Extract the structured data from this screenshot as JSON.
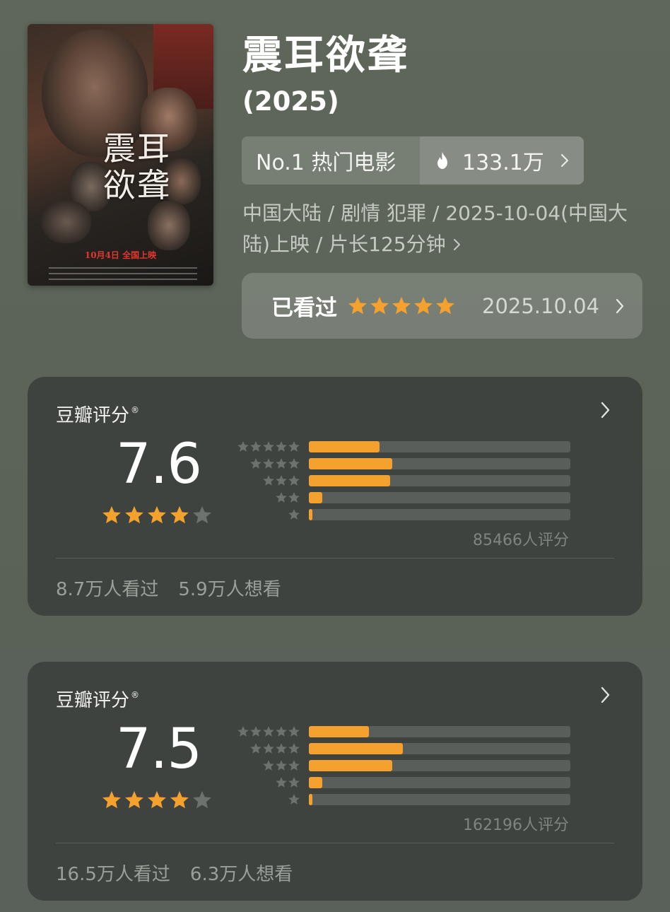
{
  "movie": {
    "poster_title": "震耳欲聋",
    "poster_release": "10月4日 全国上映",
    "title": "震耳欲聋",
    "year": "(2025)",
    "rank_label": "No.1 热门电影",
    "heat": "133.1万",
    "meta": "中国大陆 / 剧情 犯罪 / 2025-10-04(中国大陆)上映 / 片长125分钟",
    "watched": {
      "label": "已看过",
      "stars": 5,
      "date": "2025.10.04"
    }
  },
  "ratings": [
    {
      "title": "豆瓣评分",
      "mark": "®",
      "score": "7.6",
      "stars": 4,
      "distribution": [
        0.27,
        0.32,
        0.31,
        0.05,
        0.01
      ],
      "count": "85466人评分",
      "seen": "8.7万人看过",
      "want": "5.9万人想看"
    },
    {
      "title": "豆瓣评分",
      "mark": "®",
      "score": "7.5",
      "stars": 4,
      "distribution": [
        0.23,
        0.36,
        0.32,
        0.05,
        0.01
      ],
      "count": "162196人评分",
      "seen": "16.5万人看过",
      "want": "6.3万人想看"
    }
  ],
  "colors": {
    "star_active": "#f4a22d",
    "star_inactive": "#6e726d",
    "bar_fill": "#f4a22d"
  },
  "icons": {
    "heat": "flame-icon",
    "more": "chevron-right-icon",
    "star": "star-icon"
  }
}
